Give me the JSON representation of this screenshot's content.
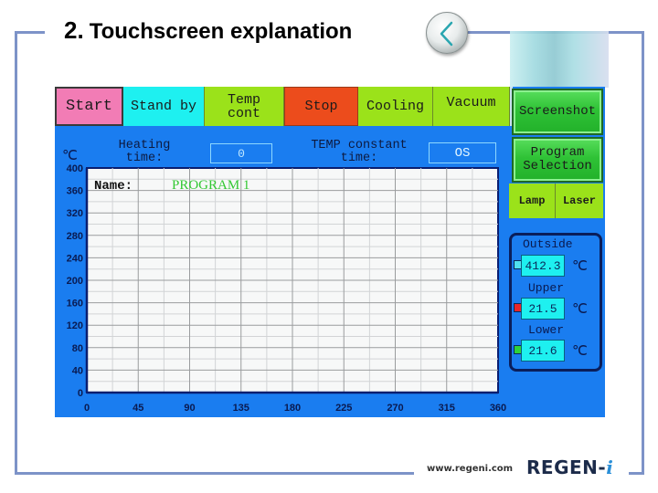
{
  "slide": {
    "number": "2.",
    "title": "Touchscreen explanation",
    "back_icon": "chevron-left-icon"
  },
  "toolbar": {
    "buttons": [
      {
        "label": "Start",
        "color": "#f27cb5"
      },
      {
        "label": "Stand by",
        "color": "#1ef0f0"
      },
      {
        "label": "Temp\ncont",
        "color": "#9be21a"
      },
      {
        "label": "Stop",
        "color": "#ec4c1c"
      },
      {
        "label": "Cooling",
        "color": "#9be21a"
      },
      {
        "label": "Vacuum",
        "color": "#9be21a"
      }
    ],
    "screenshot_label": "Screenshot",
    "program_selection_label": "Program\nSelection",
    "lamp_label": "Lamp",
    "laser_label": "Laser"
  },
  "fields": {
    "unit": "℃",
    "heating_time_label": "Heating\ntime:",
    "heating_time_value": "0",
    "temp_constant_label": "TEMP constant\ntime:",
    "temp_constant_value": "OS"
  },
  "program": {
    "name_label": "Name:",
    "name_value": "PROGRAM 1"
  },
  "temperatures": {
    "unit": "℃",
    "outside": {
      "label": "Outside",
      "value": "412.3",
      "color": "#4fe0f0"
    },
    "upper": {
      "label": "Upper",
      "value": "21.5",
      "color": "#e8262a"
    },
    "lower": {
      "label": "Lower",
      "value": "21.6",
      "color": "#2ed23a"
    }
  },
  "chart_data": {
    "type": "line",
    "title": "",
    "xlabel": "",
    "ylabel": "℃",
    "xlim": [
      0,
      360
    ],
    "ylim": [
      0,
      400
    ],
    "x_ticks": [
      "0",
      "45",
      "90",
      "135",
      "180",
      "225",
      "270",
      "315",
      "360"
    ],
    "y_ticks": [
      "0",
      "40",
      "80",
      "120",
      "160",
      "200",
      "240",
      "280",
      "320",
      "360",
      "400"
    ],
    "grid": true,
    "series": []
  },
  "footer": {
    "url": "www.regeni.com",
    "logo": "REGEN-",
    "logo_i": "i"
  }
}
